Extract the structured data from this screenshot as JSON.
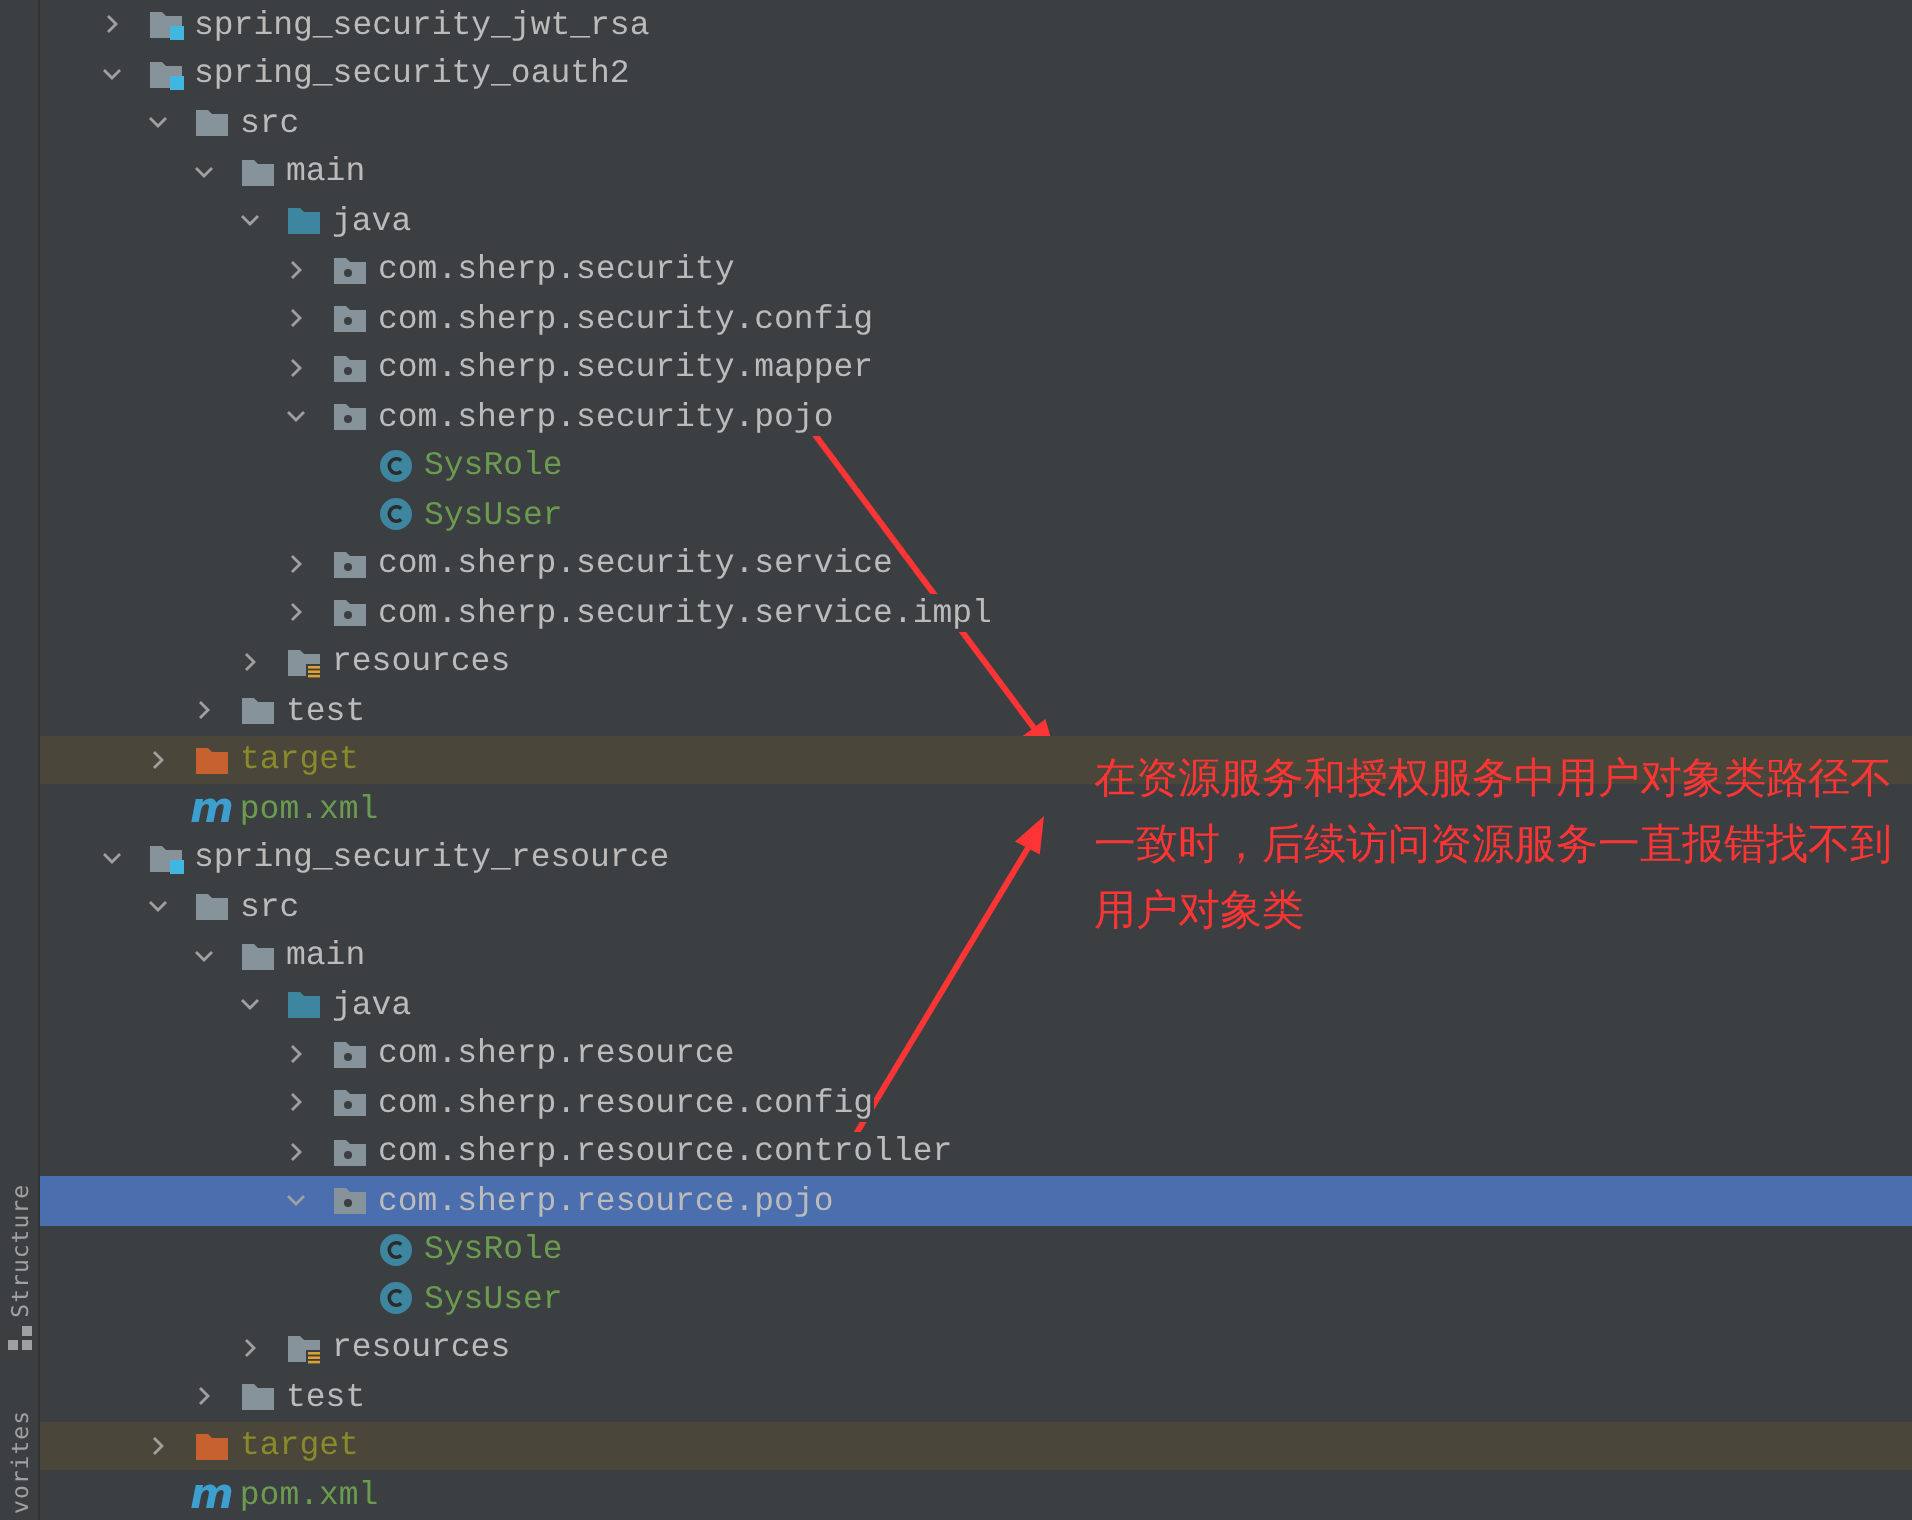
{
  "tool_strip": [
    {
      "label": "Structure",
      "kind": "structure"
    },
    {
      "label": "vorites",
      "kind": "favorites"
    }
  ],
  "tree": [
    {
      "label": "spring_security_jwt_rsa",
      "kind": "module",
      "expanded": false,
      "selected": false
    },
    {
      "label": "spring_security_oauth2",
      "kind": "module",
      "expanded": true,
      "selected": false,
      "children": [
        {
          "label": "src",
          "kind": "folder",
          "expanded": true,
          "selected": false,
          "children": [
            {
              "label": "main",
              "kind": "folder",
              "expanded": true,
              "selected": false,
              "children": [
                {
                  "label": "java",
                  "kind": "source",
                  "expanded": true,
                  "selected": false,
                  "children": [
                    {
                      "label": "com.sherp.security",
                      "kind": "package",
                      "expanded": false,
                      "selected": false
                    },
                    {
                      "label": "com.sherp.security.config",
                      "kind": "package",
                      "expanded": false,
                      "selected": false
                    },
                    {
                      "label": "com.sherp.security.mapper",
                      "kind": "package",
                      "expanded": false,
                      "selected": false
                    },
                    {
                      "label": "com.sherp.security.pojo",
                      "kind": "package",
                      "expanded": true,
                      "selected": false,
                      "children": [
                        {
                          "label": "SysRole",
                          "kind": "class",
                          "selected": false
                        },
                        {
                          "label": "SysUser",
                          "kind": "class",
                          "selected": false
                        }
                      ]
                    },
                    {
                      "label": "com.sherp.security.service",
                      "kind": "package",
                      "expanded": false,
                      "selected": false
                    },
                    {
                      "label": "com.sherp.security.service.impl",
                      "kind": "package",
                      "expanded": false,
                      "selected": false
                    }
                  ]
                },
                {
                  "label": "resources",
                  "kind": "resources",
                  "expanded": false,
                  "selected": false
                }
              ]
            },
            {
              "label": "test",
              "kind": "folder",
              "expanded": false,
              "selected": false
            }
          ]
        },
        {
          "label": "target",
          "kind": "excluded",
          "expanded": false,
          "selected": false
        },
        {
          "label": "pom.xml",
          "kind": "maven",
          "badge": "m",
          "selected": false
        }
      ]
    },
    {
      "label": "spring_security_resource",
      "kind": "module",
      "expanded": true,
      "selected": false,
      "children": [
        {
          "label": "src",
          "kind": "folder",
          "expanded": true,
          "selected": false,
          "children": [
            {
              "label": "main",
              "kind": "folder",
              "expanded": true,
              "selected": false,
              "children": [
                {
                  "label": "java",
                  "kind": "source",
                  "expanded": true,
                  "selected": false,
                  "children": [
                    {
                      "label": "com.sherp.resource",
                      "kind": "package",
                      "expanded": false,
                      "selected": false
                    },
                    {
                      "label": "com.sherp.resource.config",
                      "kind": "package",
                      "expanded": false,
                      "selected": false
                    },
                    {
                      "label": "com.sherp.resource.controller",
                      "kind": "package",
                      "expanded": false,
                      "selected": false
                    },
                    {
                      "label": "com.sherp.resource.pojo",
                      "kind": "package",
                      "expanded": true,
                      "selected": true,
                      "children": [
                        {
                          "label": "SysRole",
                          "kind": "class",
                          "selected": false
                        },
                        {
                          "label": "SysUser",
                          "kind": "class",
                          "selected": false
                        }
                      ]
                    }
                  ]
                },
                {
                  "label": "resources",
                  "kind": "resources",
                  "expanded": false,
                  "selected": false
                }
              ]
            },
            {
              "label": "test",
              "kind": "folder",
              "expanded": false,
              "selected": false
            }
          ]
        },
        {
          "label": "target",
          "kind": "excluded",
          "expanded": false,
          "selected": false
        },
        {
          "label": "pom.xml",
          "kind": "maven",
          "badge": "m",
          "selected": false
        }
      ]
    }
  ],
  "annotation": {
    "text": "在资源服务和授权服务中用户对象类路径不一致时，后续访问资源服务一直报错找不到用户对象类"
  }
}
